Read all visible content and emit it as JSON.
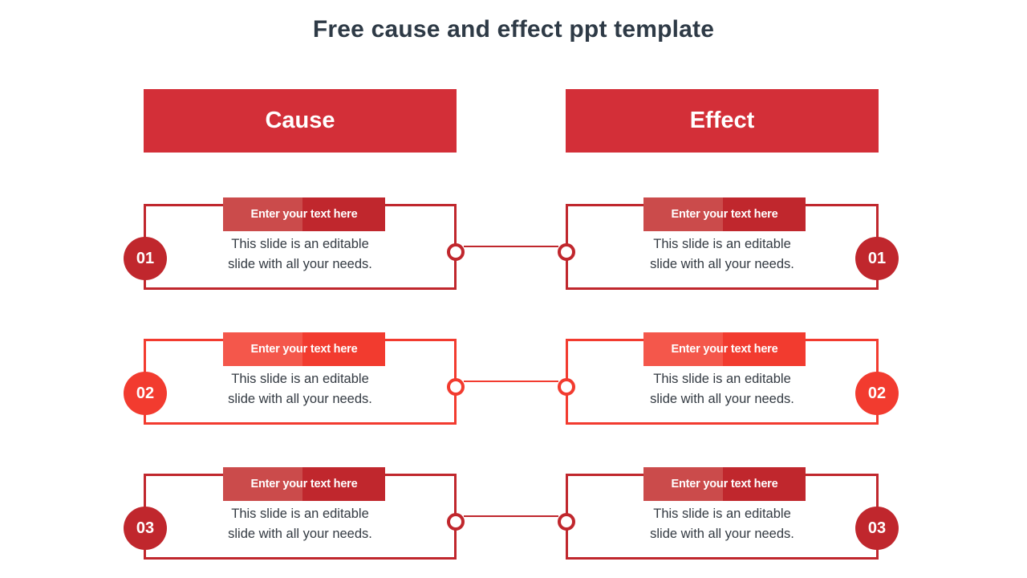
{
  "title": "Free cause and effect ppt template",
  "columns": {
    "cause_label": "Cause",
    "effect_label": "Effect"
  },
  "colors": {
    "banner": "#D32F38",
    "accent_dark": "#C0272D",
    "accent_dark_light": "#CB4B4B",
    "accent_bright": "#F23B2F",
    "accent_bright_light": "#F4574B",
    "title_text": "#2E3A46",
    "body_text": "#333A42"
  },
  "chip_label": "Enter your text here",
  "body_text": "This slide is an editable\nslide with all your needs.",
  "rows": [
    {
      "number": "01",
      "accent": "#C0272D",
      "accent_light": "#CB4B4B",
      "cause": {
        "chip": "Enter your text here",
        "body": "This slide is an editable\nslide with all your needs."
      },
      "effect": {
        "chip": "Enter your text here",
        "body": "This slide is an editable\nslide with all your needs."
      }
    },
    {
      "number": "02",
      "accent": "#F23B2F",
      "accent_light": "#F4574B",
      "cause": {
        "chip": "Enter your text here",
        "body": "This slide is an editable\nslide with all your needs."
      },
      "effect": {
        "chip": "Enter your text here",
        "body": "This slide is an editable\nslide with all your needs."
      }
    },
    {
      "number": "03",
      "accent": "#C0272D",
      "accent_light": "#CB4B4B",
      "cause": {
        "chip": "Enter your text here",
        "body": "This slide is an editable\nslide with all your needs."
      },
      "effect": {
        "chip": "Enter your text here",
        "body": "This slide is an editable\nslide with all your needs."
      }
    }
  ]
}
